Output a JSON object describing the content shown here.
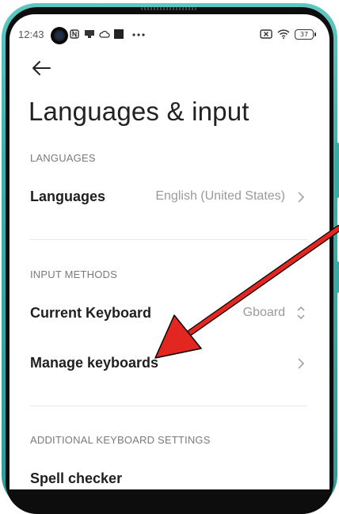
{
  "status_bar": {
    "time": "12:43",
    "battery": "37",
    "icons": [
      "nfc-icon",
      "cast-icon",
      "cloud-icon",
      "square-icon",
      "more-dots-icon",
      "sim-x-icon",
      "wifi-icon",
      "battery-icon"
    ]
  },
  "page": {
    "title": "Languages & input"
  },
  "sections": {
    "languages": {
      "header": "LANGUAGES",
      "label": "Languages",
      "value": "English (United States)"
    },
    "input_methods": {
      "header": "INPUT METHODS",
      "current_keyboard_label": "Current Keyboard",
      "current_keyboard_value": "Gboard",
      "manage_keyboards_label": "Manage keyboards"
    },
    "additional": {
      "header": "ADDITIONAL KEYBOARD SETTINGS",
      "spell_checker_label": "Spell checker"
    }
  },
  "annotation": {
    "color": "#e32620",
    "target": "Manage keyboards"
  },
  "colors": {
    "bezel": "#3fb1ab",
    "text_primary": "#1f1f1f",
    "text_secondary": "#7a7a7a"
  }
}
